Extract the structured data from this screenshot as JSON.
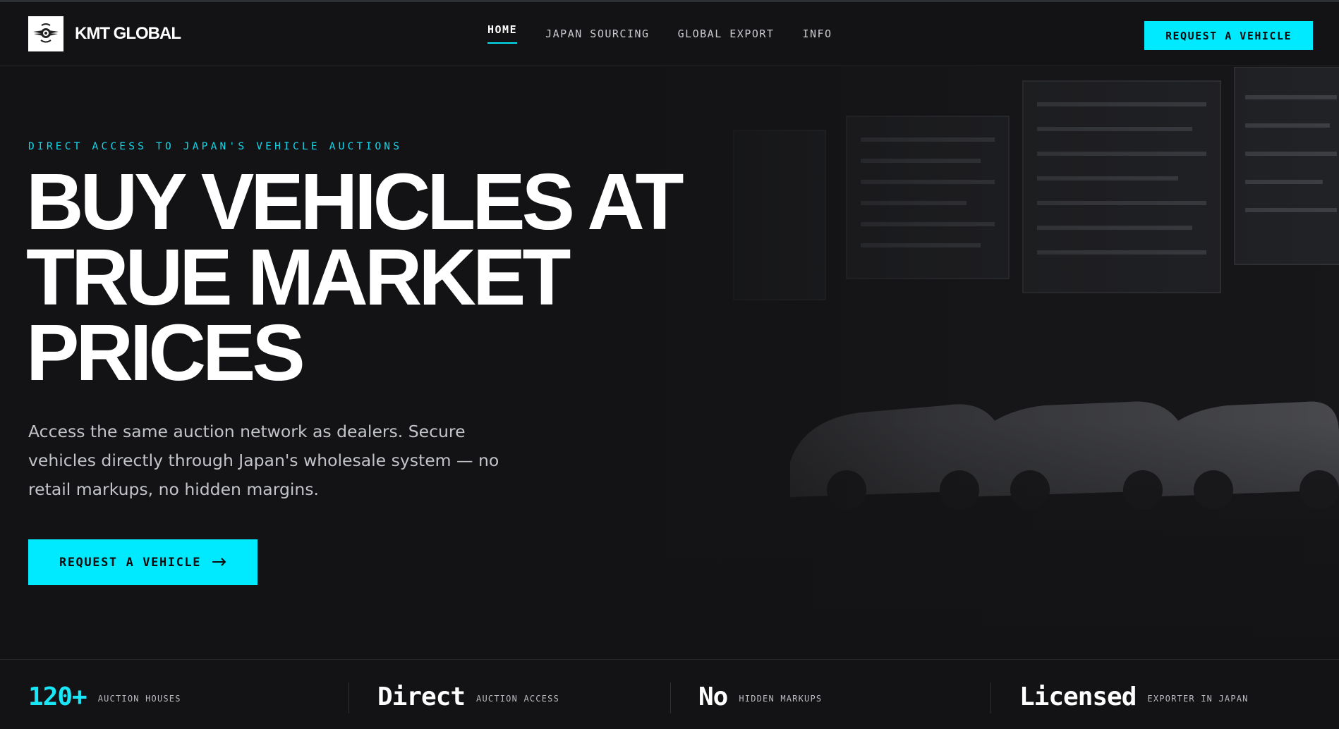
{
  "brand": {
    "name": "KMT GLOBAL",
    "logo_icon": "winged-emblem-icon"
  },
  "nav": {
    "items": [
      {
        "label": "HOME",
        "active": true
      },
      {
        "label": "JAPAN SOURCING",
        "active": false
      },
      {
        "label": "GLOBAL EXPORT",
        "active": false
      },
      {
        "label": "INFO",
        "active": false
      }
    ],
    "cta_label": "REQUEST A VEHICLE"
  },
  "hero": {
    "eyebrow": "DIRECT ACCESS TO JAPAN'S VEHICLE AUCTIONS",
    "headline": [
      "BUY VEHICLES AT",
      "TRUE MARKET",
      "PRICES"
    ],
    "lead": "Access the same auction network as dealers. Secure vehicles directly through Japan's wholesale system — no retail markups, no hidden margins.",
    "cta_label": "REQUEST A VEHICLE",
    "cta_icon": "arrow-right-icon"
  },
  "stats": [
    {
      "value": "120+",
      "label": "AUCTION HOUSES",
      "accent": true
    },
    {
      "value": "Direct",
      "label": "AUCTION ACCESS",
      "accent": false
    },
    {
      "value": "No",
      "label": "HIDDEN MARKUPS",
      "accent": false
    },
    {
      "value": "Licensed",
      "label": "EXPORTER IN JAPAN",
      "accent": false
    }
  ],
  "colors": {
    "accent": "#00eaff",
    "background": "#131315",
    "text": "#ffffff",
    "muted": "#c2c4c9"
  }
}
